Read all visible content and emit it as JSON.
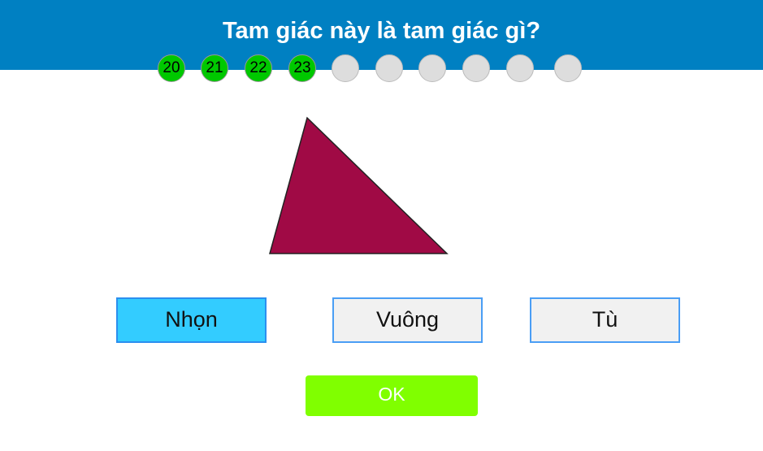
{
  "header": {
    "title": "Tam giác này là tam giác gì?",
    "color": "#0080C2"
  },
  "progress": [
    {
      "label": "20",
      "state": "done"
    },
    {
      "label": "21",
      "state": "done"
    },
    {
      "label": "22",
      "state": "done"
    },
    {
      "label": "23",
      "state": "done"
    },
    {
      "label": "",
      "state": "pending"
    },
    {
      "label": "",
      "state": "pending"
    },
    {
      "label": "",
      "state": "pending"
    },
    {
      "label": "",
      "state": "pending"
    },
    {
      "label": "",
      "state": "pending"
    },
    {
      "label": "",
      "state": "pending"
    }
  ],
  "shape": {
    "type": "triangle",
    "fill": "#A00A45"
  },
  "options": [
    {
      "label": "Nhọn",
      "selected": true
    },
    {
      "label": "Vuông",
      "selected": false
    },
    {
      "label": "Tù",
      "selected": false
    }
  ],
  "ok_label": "OK"
}
